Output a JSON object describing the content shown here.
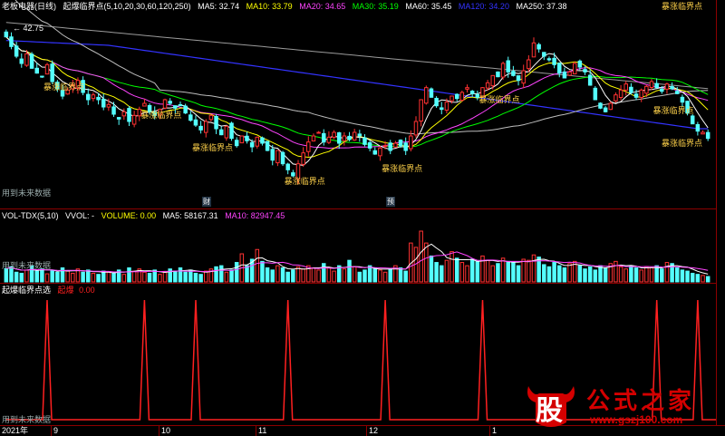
{
  "price_header": {
    "title": "老板电器(日线)",
    "indicator": "起爆临界点(5,10,20,30,60,120,250)",
    "ma5": "MA5: 32.74",
    "ma10": "MA10: 33.79",
    "ma20": "MA20: 34.65",
    "ma30": "MA30: 35.19",
    "ma60": "MA60: 35.45",
    "ma120": "MA120: 34.20",
    "ma250": "MA250: 37.38"
  },
  "high_label": "42.75",
  "signal_label": "暴涨临界点",
  "future_label": "用到未来数据",
  "markers": {
    "cai": "财",
    "yi": "预"
  },
  "vol_header": {
    "name": "VOL-TDX(5,10)",
    "vvol": "VVOL: -",
    "volume": "VOLUME: 0.00",
    "ma5": "MA5: 58167.31",
    "ma10": "MA10: 82947.45"
  },
  "ind_header": {
    "name": "起爆临界点选",
    "signal": "起爆",
    "value": "0.00"
  },
  "axis": {
    "year": "2021年",
    "months": [
      "9",
      "10",
      "11",
      "12",
      "1"
    ]
  },
  "watermark": {
    "badge": "股",
    "title": "公式之家",
    "url": "www.gszj100.com"
  },
  "colors": {
    "up": "#ff3232",
    "down": "#54ffff",
    "ma5": "#ffffff",
    "ma10": "#ffff00",
    "ma20": "#ff44ff",
    "ma30": "#00ff00",
    "ma60": "#bdbdbd",
    "ma120": "#3333ff",
    "ma250": "#9b9b9b",
    "signal": "#ff2020"
  },
  "chart_data": {
    "type": "candlestick",
    "series_note": "",
    "price_range": [
      28.5,
      43.5
    ],
    "closes": [
      41.8,
      41.0,
      40.2,
      39.6,
      40.4,
      39.2,
      38.8,
      38.5,
      39.5,
      38.1,
      37.5,
      36.9,
      37.4,
      37.8,
      38.2,
      37.2,
      36.6,
      37.0,
      36.6,
      36.0,
      36.2,
      35.4,
      35.0,
      35.6,
      34.8,
      35.3,
      35.8,
      36.3,
      35.6,
      35.3,
      35.8,
      36.6,
      36.3,
      35.9,
      36.1,
      35.5,
      34.9,
      34.5,
      34.1,
      34.8,
      35.3,
      34.2,
      33.7,
      34.4,
      33.4,
      32.8,
      33.6,
      33.2,
      32.7,
      33.5,
      33.0,
      32.4,
      31.6,
      32.4,
      31.3,
      30.8,
      30.3,
      31.3,
      32.2,
      33.1,
      33.6,
      33.9,
      33.1,
      33.5,
      33.9,
      33.0,
      33.6,
      33.3,
      33.9,
      33.6,
      32.9,
      32.6,
      32.1,
      32.6,
      32.8,
      32.4,
      33.0,
      32.8,
      32.4,
      33.6,
      34.8,
      36.6,
      37.6,
      36.8,
      36.1,
      35.8,
      36.4,
      36.9,
      36.7,
      37.2,
      37.6,
      37.1,
      36.8,
      37.6,
      38.0,
      38.6,
      38.5,
      39.6,
      38.9,
      38.6,
      38.2,
      39.0,
      39.9,
      41.3,
      40.8,
      40.2,
      39.9,
      39.5,
      38.8,
      38.4,
      38.9,
      39.6,
      39.3,
      38.9,
      37.8,
      36.6,
      35.9,
      35.6,
      36.3,
      37.0,
      37.4,
      37.9,
      37.2,
      36.8,
      37.4,
      37.7,
      38.1,
      37.6,
      37.3,
      37.9,
      37.5,
      37.1,
      36.4,
      35.5,
      34.6,
      34.0,
      33.9,
      33.4
    ],
    "volumes": [
      25,
      28,
      18,
      16,
      22,
      30,
      20,
      24,
      15,
      22,
      18,
      26,
      20,
      16,
      24,
      18,
      22,
      16,
      14,
      20,
      18,
      16,
      22,
      14,
      26,
      20,
      24,
      18,
      16,
      22,
      14,
      18,
      24,
      20,
      26,
      18,
      22,
      16,
      14,
      20,
      24,
      28,
      30,
      18,
      22,
      36,
      52,
      30,
      42,
      60,
      38,
      26,
      22,
      30,
      26,
      18,
      22,
      28,
      24,
      30,
      26,
      22,
      34,
      26,
      20,
      30,
      24,
      40,
      28,
      18,
      22,
      30,
      26,
      22,
      18,
      24,
      30,
      26,
      20,
      72,
      64,
      94,
      72,
      48,
      36,
      30,
      40,
      56,
      44,
      36,
      30,
      42,
      38,
      48,
      40,
      30,
      34,
      44,
      38,
      36,
      30,
      42,
      40,
      50,
      46,
      32,
      28,
      36,
      30,
      26,
      34,
      38,
      30,
      24,
      28,
      22,
      30,
      26,
      34,
      38,
      28,
      24,
      30,
      26,
      22,
      28,
      26,
      30,
      24,
      36,
      34,
      26,
      22,
      20,
      16,
      14,
      12,
      10
    ],
    "signal_spikes_index": [
      8,
      27,
      37,
      55,
      74,
      93,
      127,
      135,
      147
    ]
  }
}
